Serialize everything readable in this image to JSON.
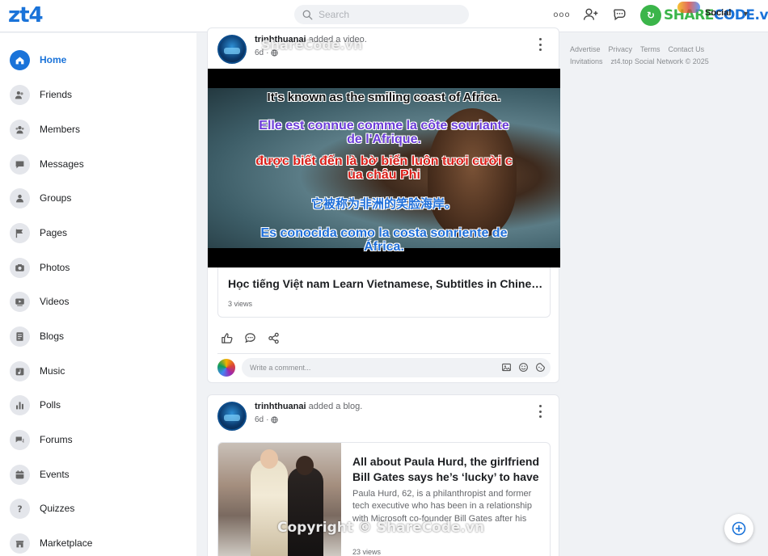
{
  "header": {
    "logo": "zt4",
    "search_placeholder": "Search",
    "more_label": "ooo",
    "sharecode_brand_left": "SHARE",
    "sharecode_brand_right": "CODE.vn",
    "social_label": "Social"
  },
  "sidebar": {
    "items": [
      {
        "label": "Home",
        "icon": "home-icon"
      },
      {
        "label": "Friends",
        "icon": "friends-icon"
      },
      {
        "label": "Members",
        "icon": "members-icon"
      },
      {
        "label": "Messages",
        "icon": "messages-icon"
      },
      {
        "label": "Groups",
        "icon": "groups-icon"
      },
      {
        "label": "Pages",
        "icon": "flag-icon"
      },
      {
        "label": "Photos",
        "icon": "camera-icon"
      },
      {
        "label": "Videos",
        "icon": "video-icon"
      },
      {
        "label": "Blogs",
        "icon": "blog-icon"
      },
      {
        "label": "Music",
        "icon": "music-icon"
      },
      {
        "label": "Polls",
        "icon": "polls-icon"
      },
      {
        "label": "Forums",
        "icon": "forums-icon"
      },
      {
        "label": "Events",
        "icon": "calendar-icon"
      },
      {
        "label": "Quizzes",
        "icon": "question-icon"
      },
      {
        "label": "Marketplace",
        "icon": "marketplace-icon"
      }
    ]
  },
  "posts": [
    {
      "username": "trinhthuanai",
      "action": "added a video.",
      "time": "6d",
      "video": {
        "subtitle_en": "It's known as the smiling coast of Africa.",
        "subtitle_fr_1": "Elle est connue comme la côte souriante",
        "subtitle_fr_2": "de l'Afrique.",
        "subtitle_vi_1": "được biết đến là bờ biển luôn tươi cười c",
        "subtitle_vi_2": "ủa châu Phi",
        "subtitle_zh": "它被称为非洲的笑脸海岸。",
        "subtitle_es_1": "Es conocida como la costa sonriente de",
        "subtitle_es_2": "África.",
        "title": "Học tiếng Việt nam Learn Vietnamese, Subtitles in Chinese, English...",
        "views": "3 views"
      },
      "comment_placeholder": "Write a comment..."
    },
    {
      "username": "trinhthuanai",
      "action": "added a blog.",
      "time": "6d",
      "blog": {
        "title": "All about Paula Hurd, the girlfriend Bill Gates says he’s ‘lucky’ to have",
        "excerpt": "Paula Hurd, 62, is a philanthropist and former tech executive who has been in a relationship with Microsoft co-founder Bill Gates after his divorce...",
        "views": "23 views"
      }
    }
  ],
  "footer_links": {
    "advertise": "Advertise",
    "privacy": "Privacy",
    "terms": "Terms",
    "contact": "Contact Us",
    "invitations": "Invitations",
    "copyright": "zt4.top Social Network © 2025"
  },
  "watermarks": {
    "top": "ShareCode.vn",
    "bottom": "Copyright © ShareCode.vn"
  },
  "colors": {
    "accent": "#1a73d9",
    "sharecode_green": "#3bb54a",
    "background": "#f0f2f5"
  }
}
